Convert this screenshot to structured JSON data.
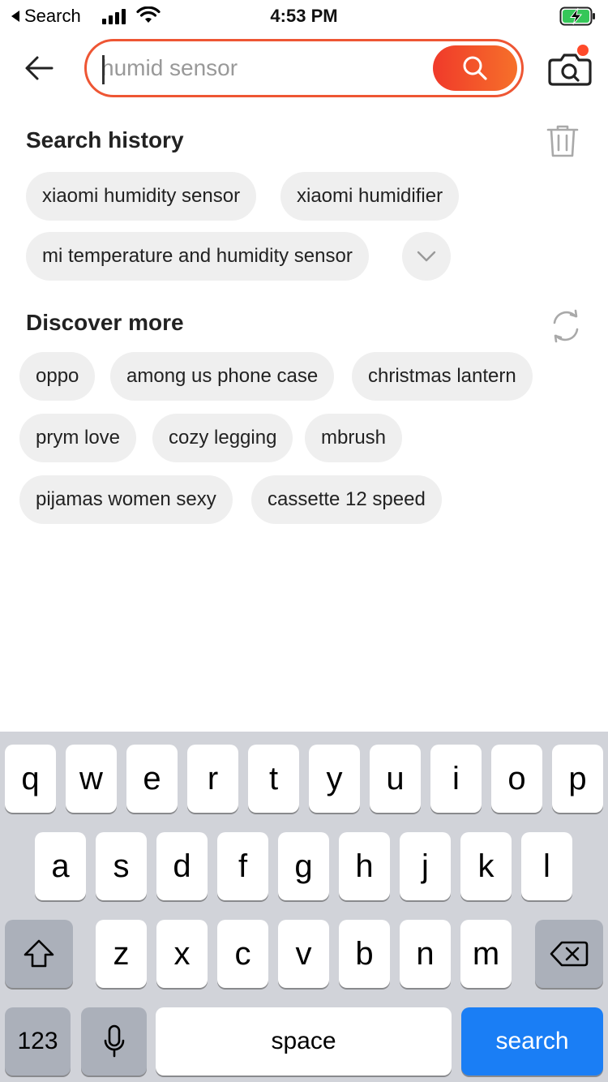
{
  "status_bar": {
    "back_app": "Search",
    "time": "4:53 PM"
  },
  "search": {
    "placeholder": "humid sensor",
    "value": ""
  },
  "history": {
    "title": "Search history",
    "items": [
      "xiaomi humidity sensor",
      "xiaomi humidifier",
      "mi temperature and humidity sensor"
    ]
  },
  "discover": {
    "title": "Discover more",
    "items": [
      "oppo",
      "among us phone case",
      "christmas lantern",
      "prym love",
      "cozy legging",
      "mbrush",
      "pijamas women sexy",
      "cassette 12 speed"
    ]
  },
  "keyboard": {
    "row1": [
      "q",
      "w",
      "e",
      "r",
      "t",
      "y",
      "u",
      "i",
      "o",
      "p"
    ],
    "row2": [
      "a",
      "s",
      "d",
      "f",
      "g",
      "h",
      "j",
      "k",
      "l"
    ],
    "row3": [
      "z",
      "x",
      "c",
      "v",
      "b",
      "n",
      "m"
    ],
    "numbers_label": "123",
    "space_label": "space",
    "search_label": "search"
  },
  "colors": {
    "accent": "#ee5634",
    "keyboard_search": "#1a7ef5",
    "chip_bg": "#efefef"
  },
  "icons": [
    "back-arrow-icon",
    "search-icon",
    "camera-icon",
    "trash-icon",
    "refresh-icon",
    "chevron-down-icon",
    "shift-icon",
    "delete-icon",
    "microphone-icon"
  ]
}
